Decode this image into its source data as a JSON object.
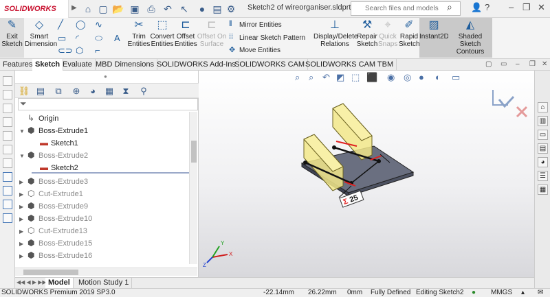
{
  "titlebar": {
    "app_logo": "SOLIDWORKS",
    "document_title": "Sketch2 of wireorganiser.sldprt *",
    "search_placeholder": "Search files and models"
  },
  "ribbon": {
    "exit_sketch": "Exit Sketch",
    "smart_dimension": "Smart Dimension",
    "trim_entities": "Trim Entities",
    "convert_entities": "Convert Entities",
    "offset_entities": "Offset Entities",
    "offset_on_surface": "Offset On Surface",
    "mirror_entities": "Mirror Entities",
    "linear_sketch_pattern": "Linear Sketch Pattern",
    "move_entities": "Move Entities",
    "display_delete_relations": "Display/Delete Relations",
    "repair_sketch": "Repair Sketch",
    "quick_snaps": "Quick Snaps",
    "rapid_sketch": "Rapid Sketch",
    "instant2d": "Instant2D",
    "shaded_sketch_contours": "Shaded Sketch Contours"
  },
  "tabs": [
    "Features",
    "Sketch",
    "Evaluate",
    "MBD Dimensions",
    "SOLIDWORKS Add-Ins",
    "SOLIDWORKS CAM",
    "SOLIDWORKS CAM TBM"
  ],
  "active_tab": "Sketch",
  "tree": [
    {
      "label": "Origin",
      "icon": "origin-icon",
      "greyed": false
    },
    {
      "label": "Boss-Extrude1",
      "icon": "extrude-icon",
      "greyed": false
    },
    {
      "label": "Sketch1",
      "icon": "sketch-icon",
      "greyed": false
    },
    {
      "label": "Boss-Extrude2",
      "icon": "extrude-icon",
      "greyed": true
    },
    {
      "label": "Sketch2",
      "icon": "sketch-icon",
      "greyed": false
    },
    {
      "label": "Boss-Extrude3",
      "icon": "extrude-icon",
      "greyed": true
    },
    {
      "label": "Cut-Extrude1",
      "icon": "cut-icon",
      "greyed": true
    },
    {
      "label": "Boss-Extrude9",
      "icon": "extrude-icon",
      "greyed": true
    },
    {
      "label": "Boss-Extrude10",
      "icon": "extrude-icon",
      "greyed": true
    },
    {
      "label": "Cut-Extrude13",
      "icon": "cut-icon",
      "greyed": true
    },
    {
      "label": "Boss-Extrude15",
      "icon": "extrude-icon",
      "greyed": true
    },
    {
      "label": "Boss-Extrude16",
      "icon": "extrude-icon",
      "greyed": true
    }
  ],
  "model": {
    "dimension_label": "25",
    "triad_x": "X",
    "triad_y": "Y",
    "triad_z": "Z"
  },
  "bottom_tabs": [
    "Model",
    "Motion Study 1"
  ],
  "status": {
    "version": "SOLIDWORKS Premium 2019 SP3.0",
    "x": "-22.14mm",
    "y": "26.22mm",
    "z": "0mm",
    "state": "Fully Defined",
    "editing": "Editing Sketch2",
    "units": "MMGS"
  },
  "colors": {
    "ribbon_selected": "#c9c9c9",
    "model_yellow": "#f2e88a",
    "model_plate": "#6a6f80",
    "dimension_red": "#e02020"
  }
}
